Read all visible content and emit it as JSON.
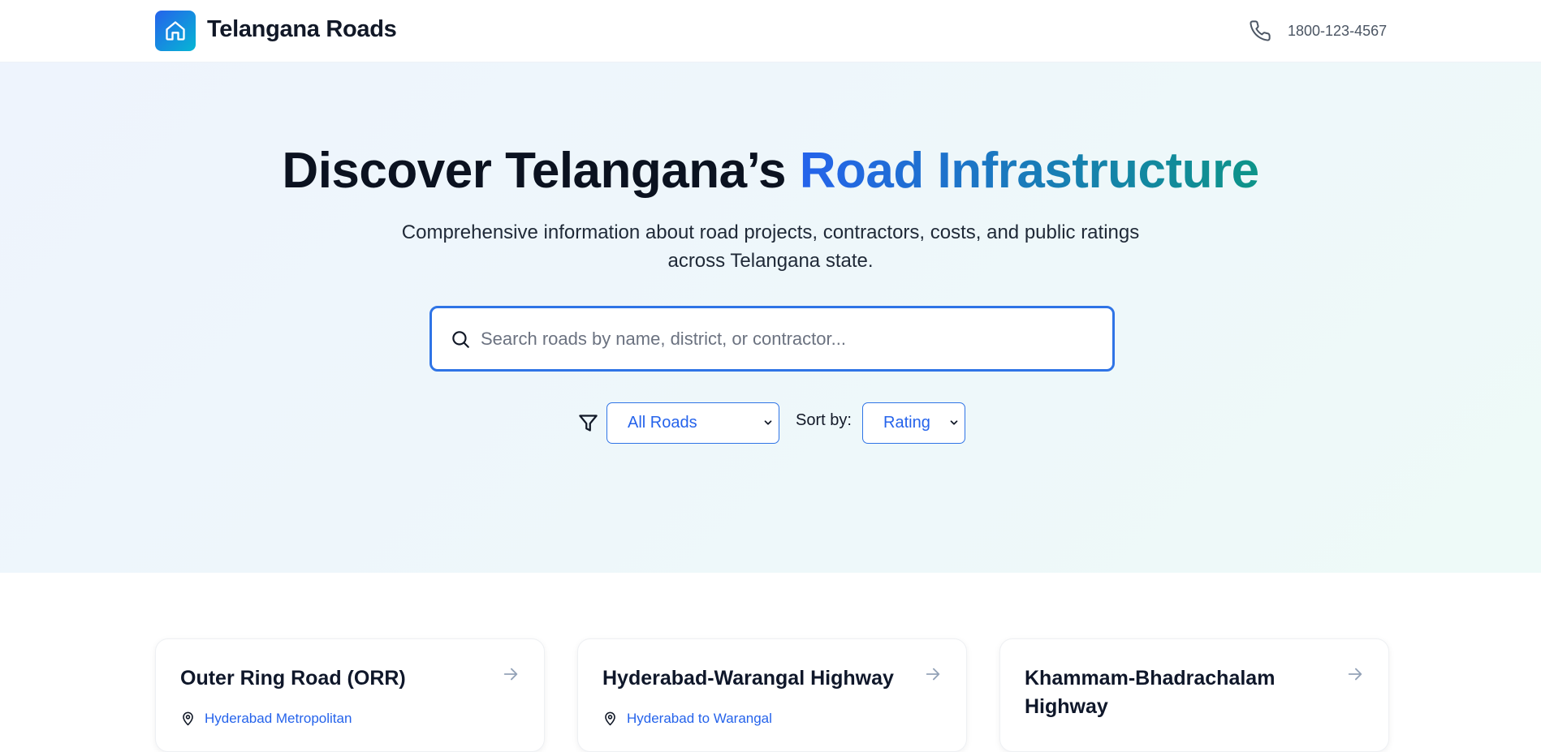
{
  "header": {
    "brand": "Telangana Roads",
    "logo_icon": "home-icon",
    "phone_icon": "phone-icon",
    "phone": "1800-123-4567"
  },
  "hero": {
    "title_main": "Discover Telangana’s ",
    "title_accent": "Road Infrastructure",
    "subtitle": "Comprehensive information about road projects, contractors, costs, and public ratings across Telangana state.",
    "search": {
      "placeholder": "Search roads by name, district, or contractor...",
      "value": ""
    },
    "filter": {
      "icon": "filter-icon",
      "selected": "All Roads"
    },
    "sort": {
      "label": "Sort by:",
      "selected": "Rating"
    }
  },
  "cards": [
    {
      "title": "Outer Ring Road (ORR)",
      "location": "Hyderabad Metropolitan"
    },
    {
      "title": "Hyderabad-Warangal Highway",
      "location": "Hyderabad to Warangal"
    },
    {
      "title": "Khammam-Bhadrachalam Highway",
      "location": ""
    }
  ],
  "colors": {
    "accent": "#2563eb",
    "teal": "#0d9488",
    "hero_bg": "#eef4fd"
  }
}
